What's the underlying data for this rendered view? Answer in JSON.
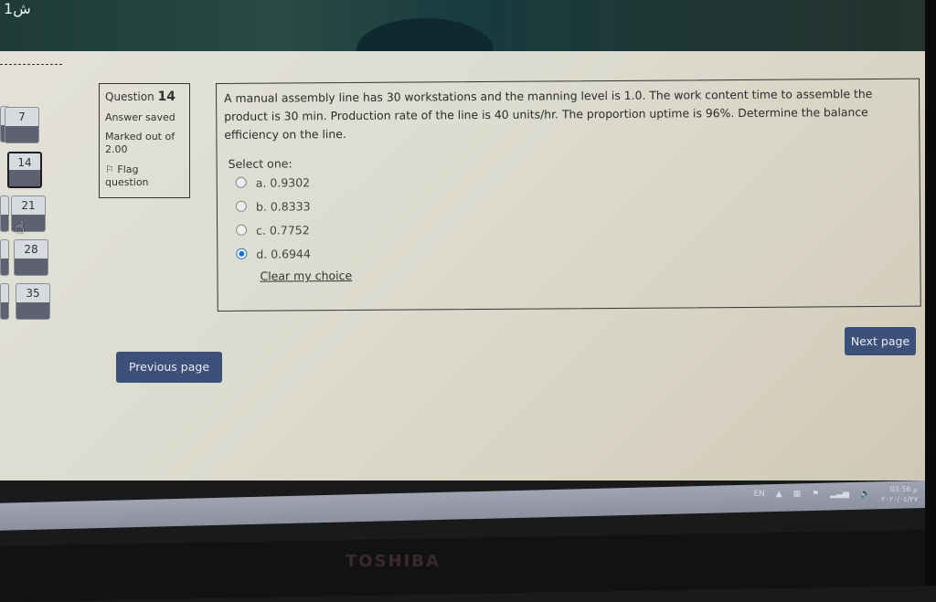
{
  "overlay": {
    "corner_label": "1ش"
  },
  "quiz_nav": {
    "buttons": [
      {
        "label": "7",
        "state": "answered"
      },
      {
        "label": "14",
        "state": "current"
      },
      {
        "label": "21",
        "state": "answered"
      },
      {
        "label": "28",
        "state": "answered"
      },
      {
        "label": "35",
        "state": "answered"
      }
    ]
  },
  "question_info": {
    "question_prefix": "Question",
    "question_number": "14",
    "status": "Answer saved",
    "marks_label": "Marked out of",
    "marks_value": "2.00",
    "flag_label": "Flag question",
    "flag_icon": "flag-icon"
  },
  "question": {
    "text": "A manual assembly line has 30 workstations and the manning level is 1.0. The work content time to assemble the product is 30 min. Production rate of the line is 40 units/hr. The proportion uptime is 96%. Determine the balance efficiency on the line.",
    "select_prompt": "Select one:",
    "options": [
      {
        "label": "a. 0.9302",
        "selected": false
      },
      {
        "label": "b. 0.8333",
        "selected": false
      },
      {
        "label": "c. 0.7752",
        "selected": false
      },
      {
        "label": "d. 0.6944",
        "selected": true
      }
    ],
    "clear_choice": "Clear my choice"
  },
  "navigation": {
    "previous_label": "Previous page",
    "next_label": "Next page"
  },
  "taskbar": {
    "language": "EN",
    "time": "03:56 م",
    "date": "٢٠٢٠/٠٤/٢٧"
  },
  "device": {
    "brand": "TOSHIBA"
  },
  "colors": {
    "button_bg": "#3c507a",
    "radio_selected": "#1a73d4",
    "nav_bar": "#5d6170"
  }
}
